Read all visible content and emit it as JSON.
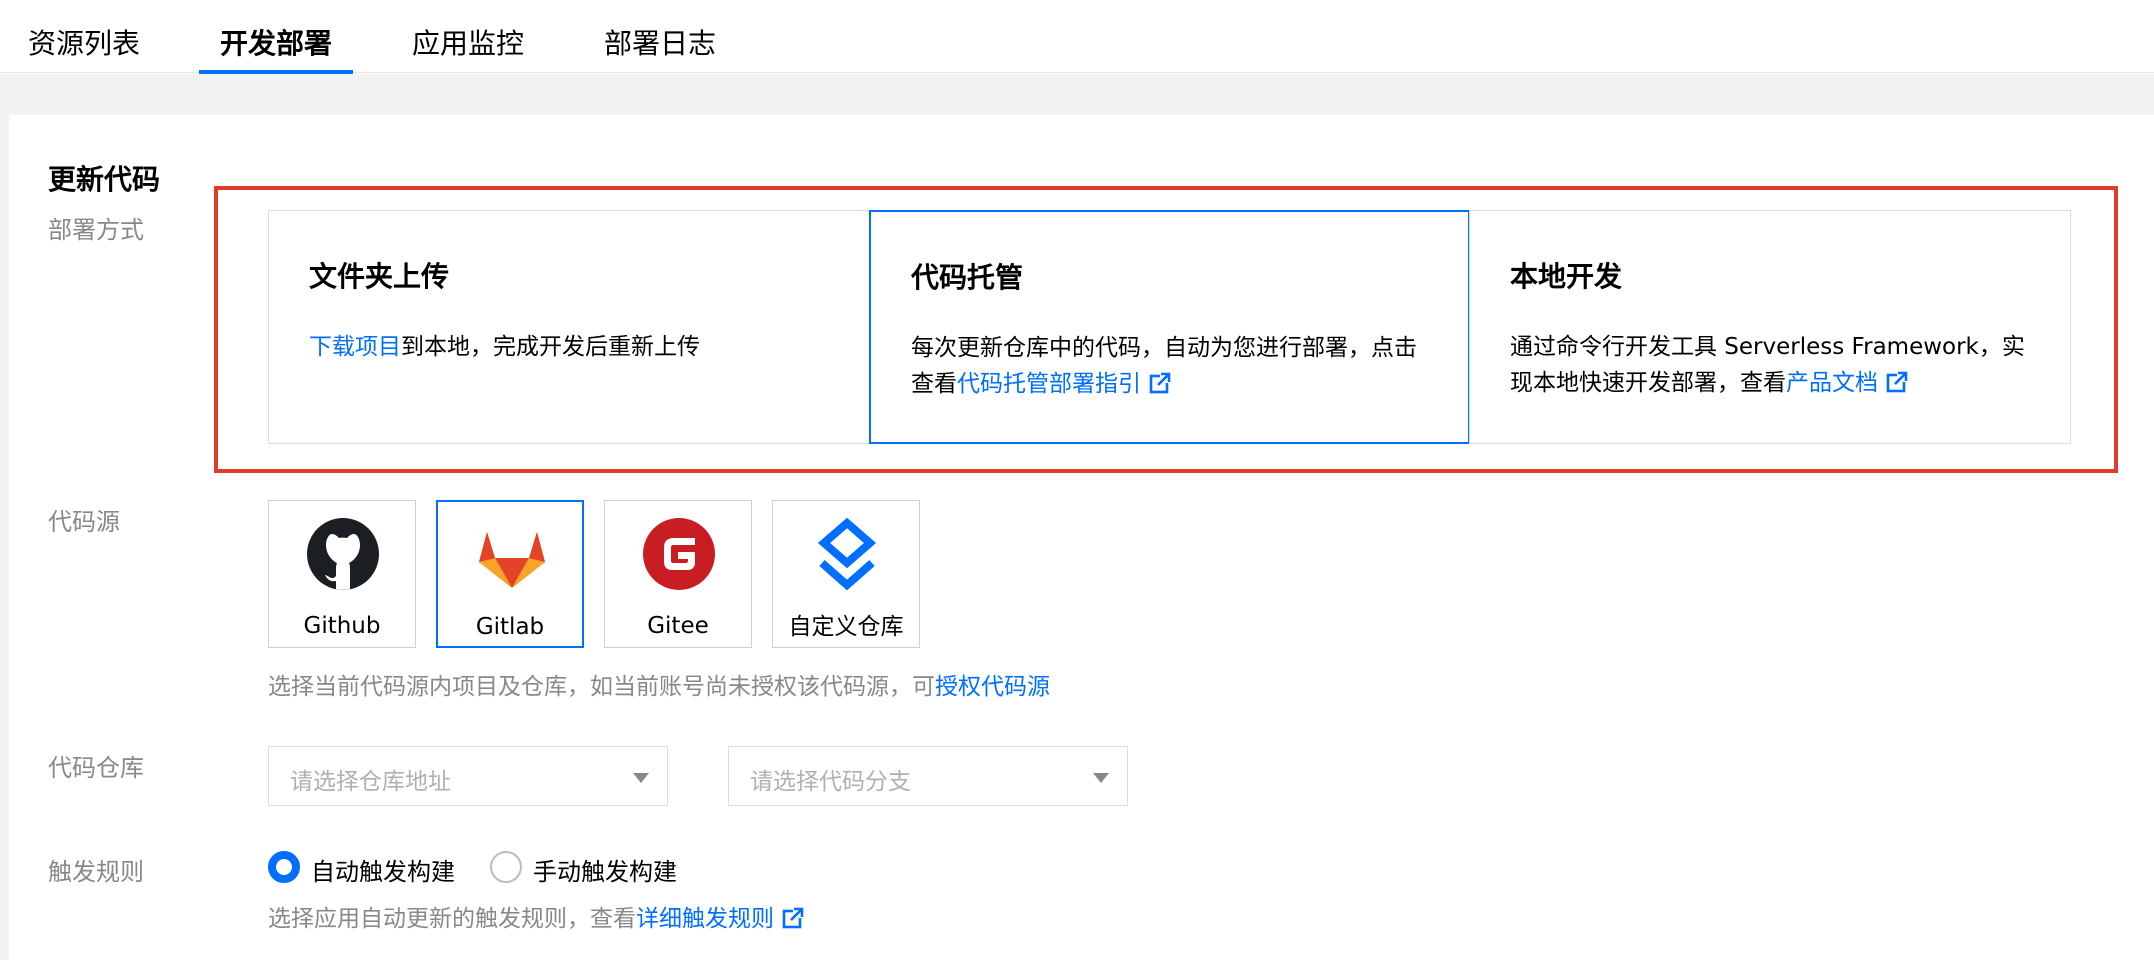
{
  "tabs": [
    {
      "label": "资源列表"
    },
    {
      "label": "开发部署"
    },
    {
      "label": "应用监控"
    },
    {
      "label": "部署日志"
    }
  ],
  "section": {
    "title": "更新代码"
  },
  "deploy": {
    "label": "部署方式",
    "methods": [
      {
        "title": "文件夹上传",
        "desc_link": "下载项目",
        "desc_text": "到本地，完成开发后重新上传"
      },
      {
        "title": "代码托管",
        "desc_text": "每次更新仓库中的代码，自动为您进行部署，点击查看",
        "desc_link": "代码托管部署指引"
      },
      {
        "title": "本地开发",
        "desc_text": "通过命令行开发工具 Serverless Framework，实现本地快速开发部署，查看",
        "desc_link": "产品文档"
      }
    ]
  },
  "source": {
    "label": "代码源",
    "items": [
      {
        "name": "Github"
      },
      {
        "name": "Gitlab"
      },
      {
        "name": "Gitee"
      },
      {
        "name": "自定义仓库"
      }
    ],
    "help_text": "选择当前代码源内项目及仓库，如当前账号尚未授权该代码源，可",
    "help_link": "授权代码源"
  },
  "repo": {
    "label": "代码仓库",
    "address_placeholder": "请选择仓库地址",
    "branch_placeholder": "请选择代码分支"
  },
  "trigger": {
    "label": "触发规则",
    "options": [
      {
        "label": "自动触发构建"
      },
      {
        "label": "手动触发构建"
      }
    ],
    "help_text": "选择应用自动更新的触发规则，查看",
    "help_link": "详细触发规则"
  },
  "colors": {
    "accent": "#006eff",
    "highlight": "#e03c2c"
  }
}
